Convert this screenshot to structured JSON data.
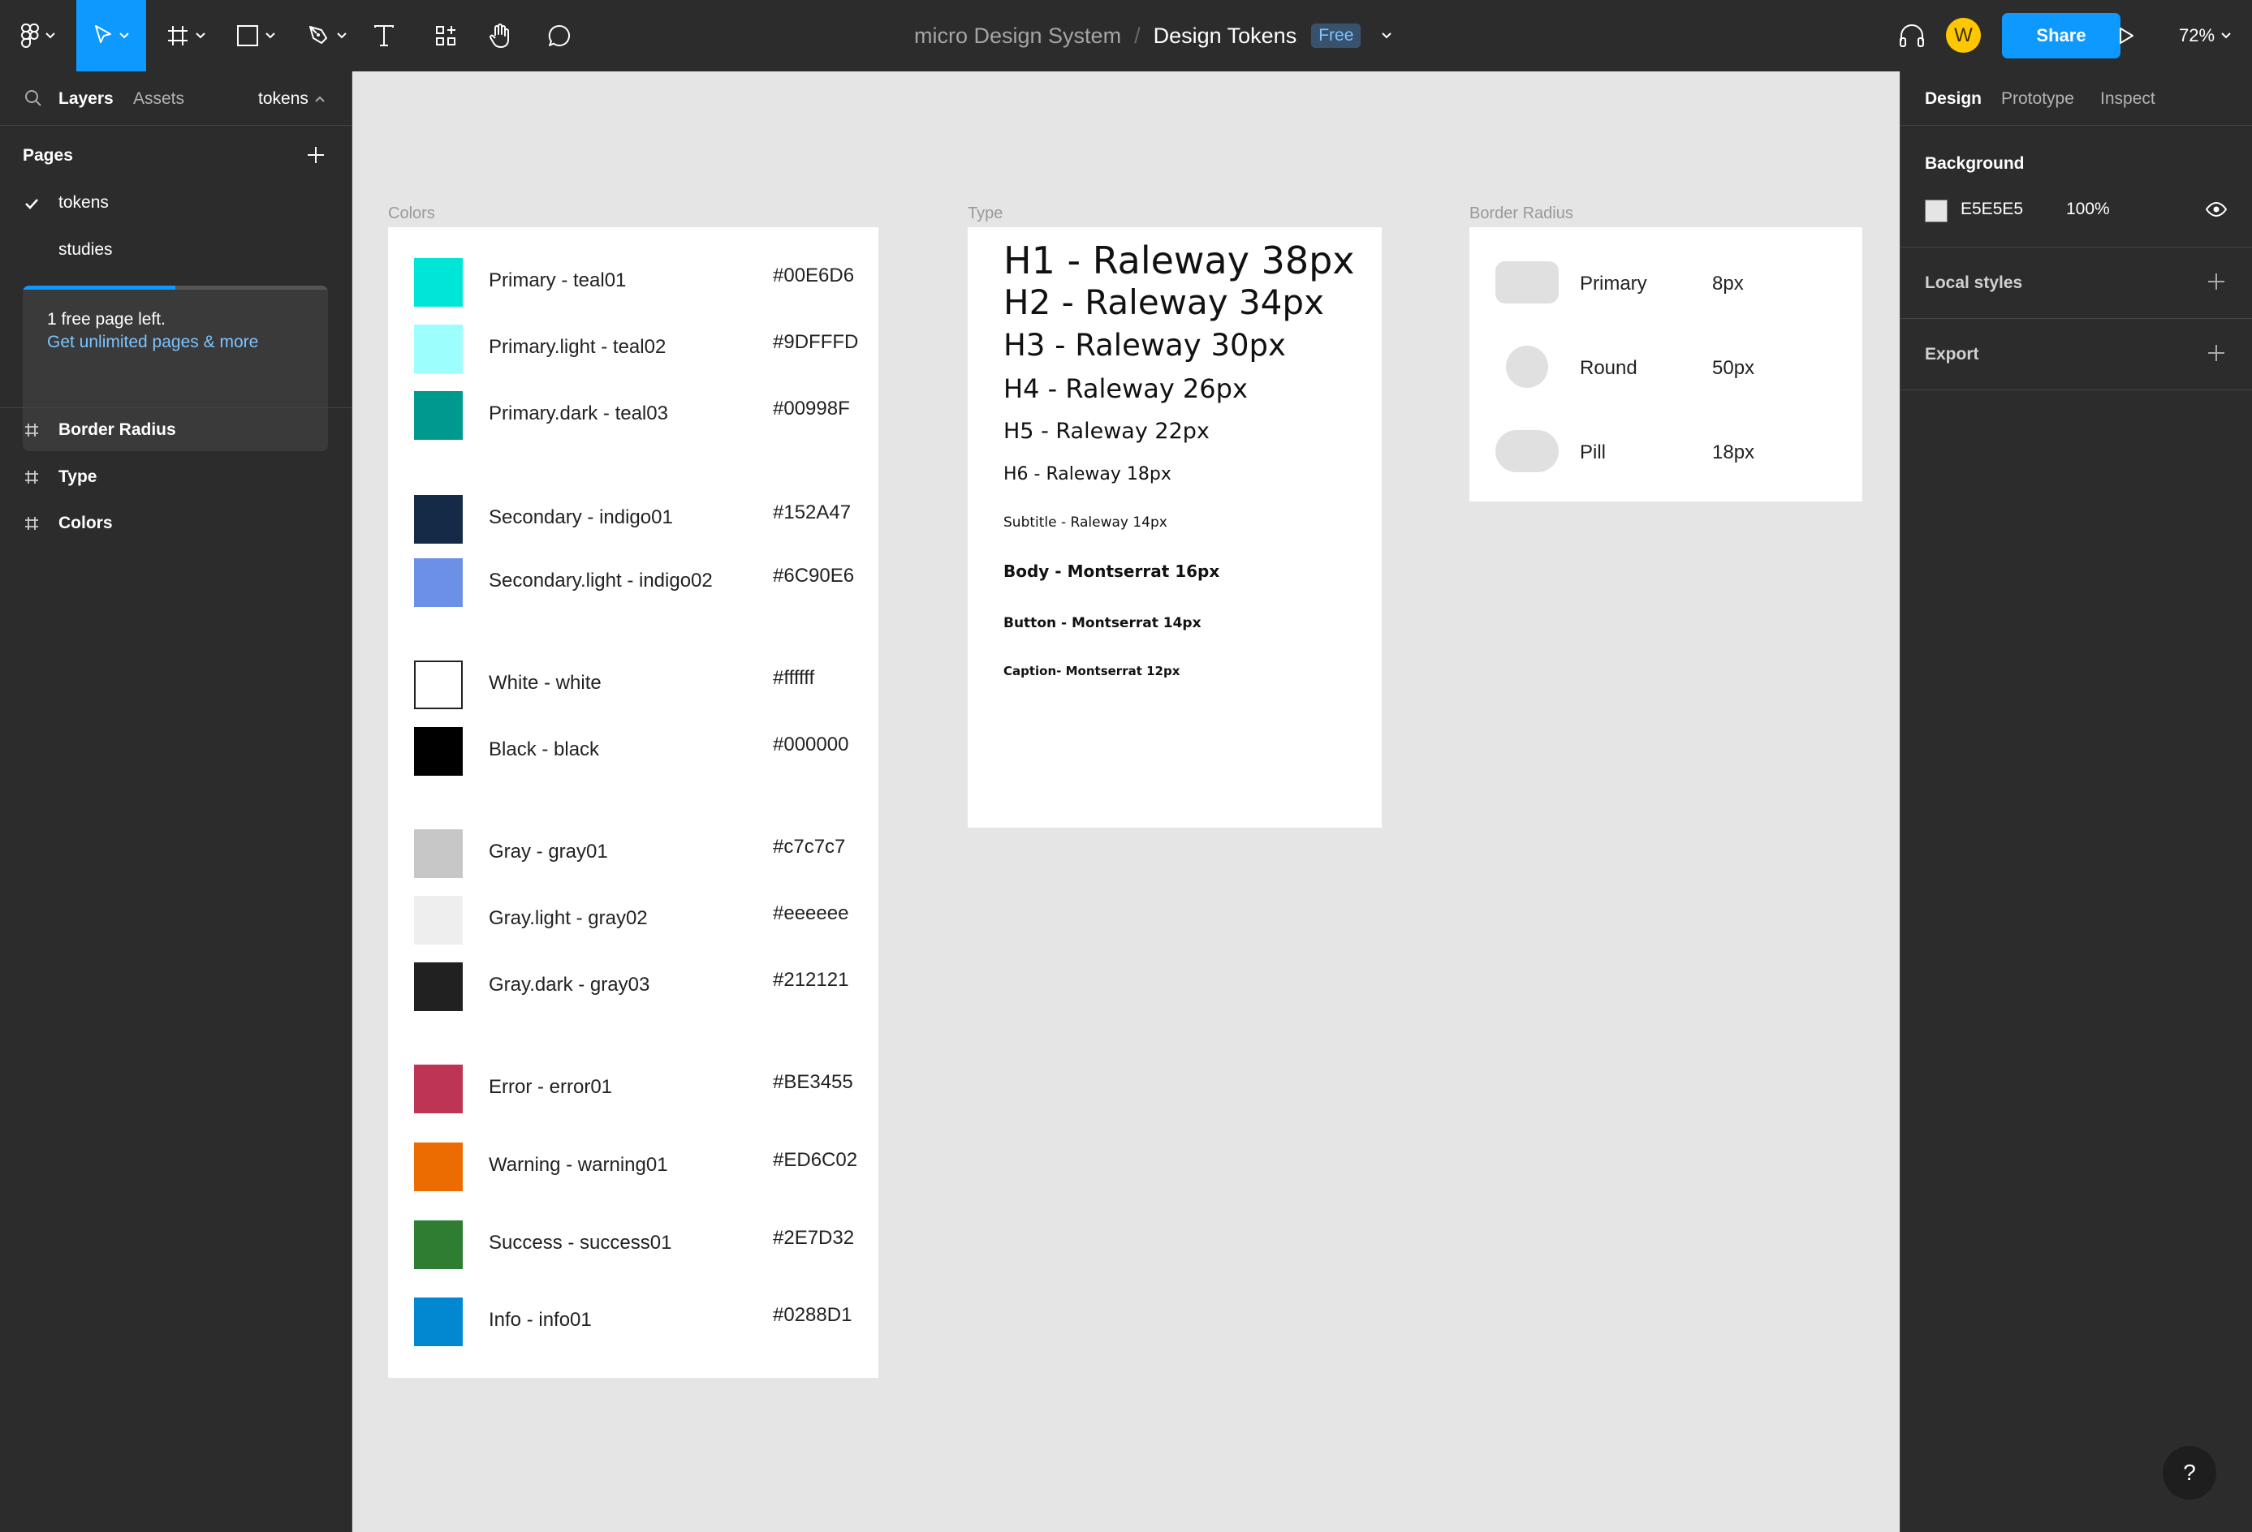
{
  "toolbar": {
    "project_name": "micro Design System",
    "separator": "/",
    "file_name": "Design Tokens",
    "plan_badge": "Free",
    "avatar_initial": "W",
    "share_label": "Share",
    "zoom": "72%",
    "icons": [
      "figma-menu-icon",
      "move-tool-icon",
      "frame-tool-icon",
      "shape-tool-icon",
      "pen-tool-icon",
      "text-tool-icon",
      "resources-icon",
      "hand-tool-icon",
      "comment-icon",
      "headphones-icon",
      "present-icon"
    ]
  },
  "left_panel": {
    "tabs": {
      "layers": "Layers",
      "assets": "Assets",
      "page_switch": "tokens"
    },
    "pages_heading": "Pages",
    "pages": [
      {
        "label": "tokens",
        "selected": true
      },
      {
        "label": "studies",
        "selected": false
      }
    ],
    "notice": {
      "line1": "1 free page left.",
      "line2": "Get unlimited pages & more",
      "progress": 0.5
    },
    "layers": [
      "Border Radius",
      "Type",
      "Colors"
    ]
  },
  "right_panel": {
    "tabs": [
      "Design",
      "Prototype",
      "Inspect"
    ],
    "background_heading": "Background",
    "background_hex": "E5E5E5",
    "background_opacity": "100%",
    "local_styles": "Local styles",
    "export": "Export",
    "help": "?"
  },
  "canvas": {
    "colors_label": "Colors",
    "type_label": "Type",
    "border_label": "Border Radius",
    "colors": [
      {
        "name": "Primary - teal01",
        "hex": "#00E6D6",
        "color": "#00E6D6"
      },
      {
        "name": "Primary.light - teal02",
        "hex": "#9DFFFD",
        "color": "#9DFFFD"
      },
      {
        "name": "Primary.dark - teal03",
        "hex": "#00998F",
        "color": "#00998F"
      },
      {
        "name": "Secondary - indigo01",
        "hex": "#152A47",
        "color": "#152A47"
      },
      {
        "name": "Secondary.light - indigo02",
        "hex": "#6C90E6",
        "color": "#6C90E6"
      },
      {
        "name": "White - white",
        "hex": "#ffffff",
        "color": "#ffffff"
      },
      {
        "name": "Black - black",
        "hex": "#000000",
        "color": "#000000"
      },
      {
        "name": "Gray - gray01",
        "hex": "#c7c7c7",
        "color": "#c7c7c7"
      },
      {
        "name": "Gray.light - gray02",
        "hex": "#eeeeee",
        "color": "#eeeeee"
      },
      {
        "name": "Gray.dark - gray03",
        "hex": "#212121",
        "color": "#212121"
      },
      {
        "name": "Error - error01",
        "hex": "#BE3455",
        "color": "#BE3455"
      },
      {
        "name": "Warning - warning01",
        "hex": "#ED6C02",
        "color": "#ED6C02"
      },
      {
        "name": "Success - success01",
        "hex": "#2E7D32",
        "color": "#2E7D32"
      },
      {
        "name": "Info - info01",
        "hex": "#0288D1",
        "color": "#0288D1"
      }
    ],
    "type_styles": [
      "H1 - Raleway 38px",
      "H2 - Raleway 34px",
      "H3 - Raleway 30px",
      "H4 - Raleway 26px",
      "H5 - Raleway 22px",
      "H6 - Raleway 18px",
      "Subtitle - Raleway 14px",
      "Body - Montserrat 16px",
      "Button - Montserrat 14px",
      "Caption- Montserrat 12px"
    ],
    "border_radius": [
      {
        "name": "Primary",
        "value": "8px"
      },
      {
        "name": "Round",
        "value": "50px"
      },
      {
        "name": "Pill",
        "value": "18px"
      }
    ]
  }
}
